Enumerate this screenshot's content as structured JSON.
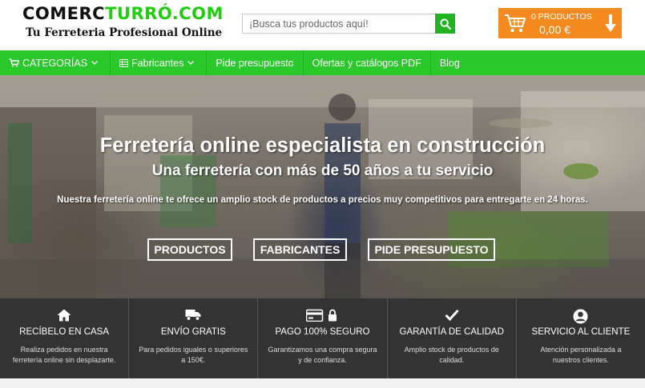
{
  "header": {
    "logo_part1": "COMERC",
    "logo_part2": "URRÓ.COM",
    "tagline": "Tu Ferreteria Profesional Online",
    "search_placeholder": "¡Busca tus productos aquí!",
    "cart_count": "0 PRODUCTOS",
    "cart_total": "0,00 €"
  },
  "nav": {
    "categories": "CATEGORÍAS",
    "manufacturers": "Fabricantes",
    "quote": "Pide presupuesto",
    "offers": "Ofertas y catálogos PDF",
    "blog": "Blog"
  },
  "hero": {
    "title": "Ferretería online especialista en construcción",
    "subtitle": "Una ferretería con más de 50 años a tu servicio",
    "description": "Nuestra ferretería online te ofrece un amplio stock de productos a precios muy competitivos para entregarte en 24 horas.",
    "btn_products": "PRODUCTOS",
    "btn_manufacturers": "FABRICANTES",
    "btn_quote": "PIDE PRESUPUESTO"
  },
  "features": [
    {
      "icon": "home-icon",
      "title": "RECÍBELO EN CASA",
      "text": "Realiza pedidos en nuestra ferretería online sin desplazarte."
    },
    {
      "icon": "truck-icon",
      "title": "ENVÍO GRATIS",
      "text": "Para pedidos iguales o superiores a 150€."
    },
    {
      "icon": "credit-card-lock-icon",
      "title": "PAGO 100% SEGURO",
      "text": "Garantizamos una compra segura y de confianza."
    },
    {
      "icon": "check-icon",
      "title": "GARANTÍA DE CALIDAD",
      "text": "Amplio stock de productos de calidad."
    },
    {
      "icon": "user-circle-icon",
      "title": "SERVICIO AL CLIENTE",
      "text": "Atención personalizada a nuestros clientes."
    }
  ],
  "colors": {
    "brand_green": "#2bc82b",
    "cart_orange": "#f58a1f",
    "features_bg": "#333333"
  }
}
